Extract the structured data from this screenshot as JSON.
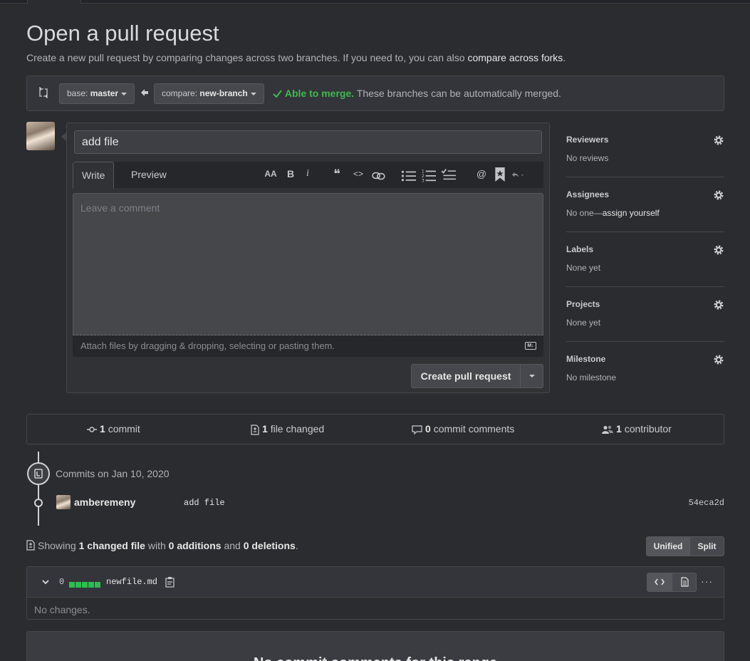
{
  "page": {
    "title": "Open a pull request",
    "subtitle_prefix": "Create a new pull request by comparing changes across two branches. If you need to, you can also",
    "subtitle_link": "compare across forks",
    "subtitle_suffix": "."
  },
  "range": {
    "base_label": "base:",
    "base_value": "master",
    "compare_label": "compare:",
    "compare_value": "new-branch",
    "merge_ok": "Able to merge.",
    "merge_text": "These branches can be automatically merged."
  },
  "composer": {
    "title_value": "add file",
    "tabs": [
      "Write",
      "Preview"
    ],
    "comment_placeholder": "Leave a comment",
    "attach_text": "Attach files by dragging & dropping, selecting or pasting them.",
    "markdown_badge": "M↓",
    "submit_label": "Create pull request",
    "toolbar": {
      "heading": "AA",
      "bold": "B",
      "italic": "i",
      "quote": "❝",
      "code": "<>",
      "link": "🔗",
      "ul": "☰",
      "ol": "☷",
      "tasks": "☑",
      "mention": "@",
      "saved": "🔖",
      "reply": "↶"
    }
  },
  "sidebar": [
    {
      "heading": "Reviewers",
      "value": "No reviews",
      "link": ""
    },
    {
      "heading": "Assignees",
      "value": "No one—",
      "link": "assign yourself"
    },
    {
      "heading": "Labels",
      "value": "None yet",
      "link": ""
    },
    {
      "heading": "Projects",
      "value": "None yet",
      "link": ""
    },
    {
      "heading": "Milestone",
      "value": "No milestone",
      "link": ""
    }
  ],
  "summary": {
    "commits_count": "1",
    "commits_label": "commit",
    "files_count": "1",
    "files_label": "file changed",
    "comments_count": "0",
    "comments_label": "commit comments",
    "contributors_count": "1",
    "contributors_label": "contributor"
  },
  "commits": {
    "date_heading": "Commits on Jan 10, 2020",
    "author": "amberemeny",
    "message": "add file",
    "sha": "54eca2d"
  },
  "diff_summary": {
    "prefix": "Showing",
    "changed": "1 changed file",
    "with": "with",
    "additions": "0 additions",
    "and": "and",
    "deletions": "0 deletions",
    "period": ".",
    "view_unified": "Unified",
    "view_split": "Split"
  },
  "file": {
    "count": "0",
    "name": "newfile.md",
    "more": "···",
    "empty": "No changes."
  },
  "bottom": {
    "message": "No commit comments for this range"
  },
  "colors": {
    "background": "#2b2c2f",
    "success": "#3fb950",
    "diffstat_add": "#2cbe4e"
  }
}
